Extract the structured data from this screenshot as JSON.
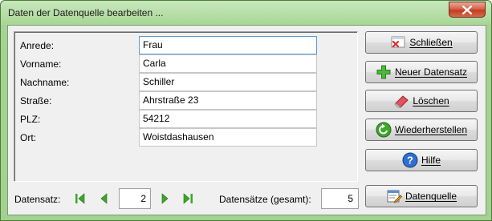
{
  "window": {
    "title": "Daten der Datenquelle bearbeiten ..."
  },
  "fields": [
    {
      "label": "Anrede:",
      "value": "Frau"
    },
    {
      "label": "Vorname:",
      "value": "Carla"
    },
    {
      "label": "Nachname:",
      "value": "Schiller"
    },
    {
      "label": "Straße:",
      "value": "Ahrstraße 23"
    },
    {
      "label": "PLZ:",
      "value": "54212"
    },
    {
      "label": "Ort:",
      "value": "Woistdashausen"
    }
  ],
  "buttons": {
    "close": "Schließen",
    "new_record": "Neuer Datensatz",
    "delete": "Löschen",
    "restore": "Wiederherstellen",
    "help": "Hilfe",
    "data_source": "Datenquelle"
  },
  "navigation": {
    "record_label": "Datensatz:",
    "current_record": "2",
    "total_label": "Datensätze (gesamt):",
    "total_records": "5"
  },
  "icons": {
    "title_close": "close-icon",
    "close": "close-document-icon",
    "new_record": "plus-icon",
    "delete": "eraser-icon",
    "restore": "undo-icon",
    "help": "help-icon",
    "data_source": "edit-data-icon",
    "first": "first-record-icon",
    "prev": "previous-record-icon",
    "next": "next-record-icon",
    "last": "last-record-icon"
  },
  "colors": {
    "frame_green": "#a5d393",
    "close_red": "#c23d22",
    "nav_green": "#3ea62c"
  }
}
